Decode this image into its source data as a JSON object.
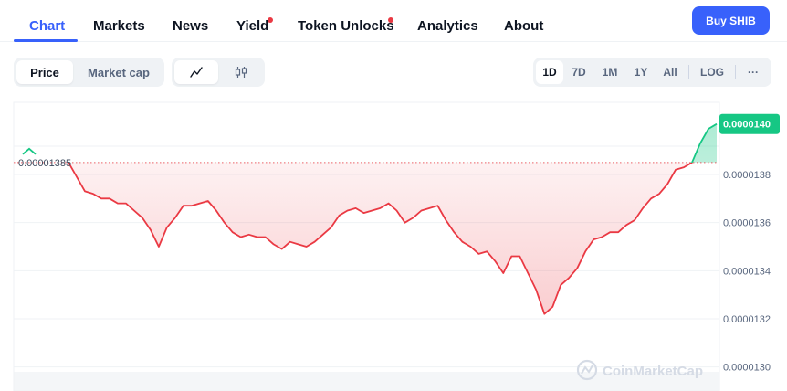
{
  "nav": {
    "tabs": [
      {
        "label": "Chart",
        "active": true,
        "dot": false
      },
      {
        "label": "Markets",
        "active": false,
        "dot": false
      },
      {
        "label": "News",
        "active": false,
        "dot": false
      },
      {
        "label": "Yield",
        "active": false,
        "dot": true
      },
      {
        "label": "Token Unlocks",
        "active": false,
        "dot": true
      },
      {
        "label": "Analytics",
        "active": false,
        "dot": false
      },
      {
        "label": "About",
        "active": false,
        "dot": false
      }
    ],
    "buy_label": "Buy SHIB"
  },
  "toolbar": {
    "metric_tabs": [
      {
        "label": "Price",
        "active": true
      },
      {
        "label": "Market cap",
        "active": false
      }
    ],
    "chart_type_icons": [
      {
        "icon": "line-chart-icon",
        "active": true
      },
      {
        "icon": "candlestick-icon",
        "active": false
      }
    ],
    "ranges": [
      {
        "label": "1D",
        "active": true
      },
      {
        "label": "7D",
        "active": false
      },
      {
        "label": "1M",
        "active": false
      },
      {
        "label": "1Y",
        "active": false
      },
      {
        "label": "All",
        "active": false
      }
    ],
    "log_label": "LOG",
    "more_label": "···"
  },
  "watermark": "CoinMarketCap",
  "colors": {
    "accent": "#3861fb",
    "up": "#16c784",
    "down": "#ea3943",
    "grid": "#eff2f5",
    "axis_text": "#58667e"
  },
  "chart_data": {
    "type": "line",
    "series": [
      {
        "values": [
          1.385e-05,
          1.379e-05,
          1.373e-05,
          1.372e-05,
          1.37e-05,
          1.37e-05,
          1.368e-05,
          1.368e-05,
          1.365e-05,
          1.362e-05,
          1.357e-05,
          1.35e-05,
          1.358e-05,
          1.362e-05,
          1.367e-05,
          1.367e-05,
          1.368e-05,
          1.369e-05,
          1.365e-05,
          1.36e-05,
          1.356e-05,
          1.354e-05,
          1.355e-05,
          1.354e-05,
          1.354e-05,
          1.351e-05,
          1.349e-05,
          1.352e-05,
          1.351e-05,
          1.35e-05,
          1.352e-05,
          1.355e-05,
          1.358e-05,
          1.363e-05,
          1.365e-05,
          1.366e-05,
          1.364e-05,
          1.365e-05,
          1.366e-05,
          1.368e-05,
          1.365e-05,
          1.36e-05,
          1.362e-05,
          1.365e-05,
          1.366e-05,
          1.367e-05,
          1.361e-05,
          1.356e-05,
          1.352e-05,
          1.35e-05,
          1.347e-05,
          1.348e-05,
          1.344e-05,
          1.339e-05,
          1.346e-05,
          1.346e-05,
          1.339e-05,
          1.332e-05,
          1.322e-05,
          1.325e-05,
          1.334e-05,
          1.337e-05,
          1.341e-05,
          1.348e-05,
          1.353e-05,
          1.354e-05,
          1.356e-05,
          1.356e-05,
          1.359e-05,
          1.361e-05,
          1.366e-05,
          1.37e-05,
          1.372e-05,
          1.376e-05,
          1.382e-05,
          1.383e-05,
          1.385e-05,
          1.393e-05,
          1.399e-05,
          1.401e-05
        ],
        "color_above_baseline": "#16c784",
        "color_below_baseline": "#ea3943"
      }
    ],
    "baseline": 1.385e-05,
    "baseline_label": "0.00001385",
    "current_label": "0.0000140",
    "y_ticks": [
      1.38e-05,
      1.36e-05,
      1.34e-05,
      1.32e-05,
      1.3e-05
    ],
    "y_tick_labels": [
      "0.0000138",
      "0.0000136",
      "0.0000134",
      "0.0000132",
      "0.0000130"
    ],
    "ylim": [
      1.29e-05,
      1.41e-05
    ],
    "grid": true,
    "xlabel": "",
    "ylabel": "",
    "title": ""
  }
}
